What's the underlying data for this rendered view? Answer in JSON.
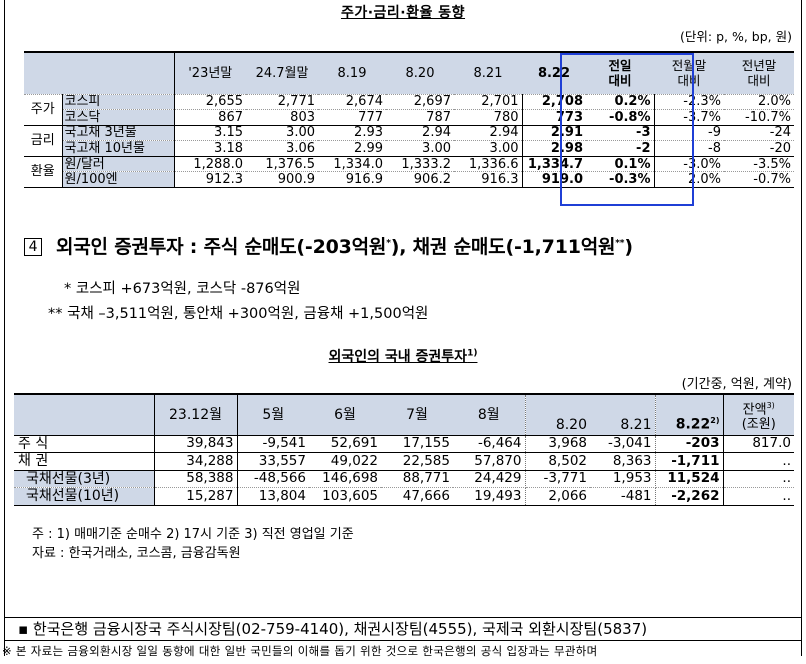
{
  "section1": {
    "title": "주가·금리·환율 동향",
    "unit_note": "(단위: p, %, bp, 원)",
    "headers": [
      "'23년말",
      "24.7월말",
      "8.19",
      "8.20",
      "8.21",
      "8.22",
      "전일\n대비",
      "전월말\n대비",
      "전년말\n대비"
    ],
    "rows": [
      {
        "group": "주가",
        "name": "코스피",
        "values": [
          "2,655",
          "2,771",
          "2,674",
          "2,697",
          "2,701",
          "2,708",
          "0.2%",
          "-2.3%",
          "2.0%"
        ]
      },
      {
        "group": "",
        "name": "코스닥",
        "values": [
          "867",
          "803",
          "777",
          "787",
          "780",
          "773",
          "-0.8%",
          "-3.7%",
          "-10.7%"
        ]
      },
      {
        "group": "금리",
        "name": "국고채 3년물",
        "values": [
          "3.15",
          "3.00",
          "2.93",
          "2.94",
          "2.94",
          "2.91",
          "-3",
          "-9",
          "-24"
        ]
      },
      {
        "group": "",
        "name": "국고채 10년물",
        "values": [
          "3.18",
          "3.06",
          "2.99",
          "3.00",
          "3.00",
          "2.98",
          "-2",
          "-8",
          "-20"
        ]
      },
      {
        "group": "환율",
        "name": "원/달러",
        "values": [
          "1,288.0",
          "1,376.5",
          "1,334.0",
          "1,333.2",
          "1,336.6",
          "1,334.7",
          "0.1%",
          "-3.0%",
          "-3.5%"
        ]
      },
      {
        "group": "",
        "name": "원/100엔",
        "values": [
          "912.3",
          "900.9",
          "916.9",
          "906.2",
          "916.3",
          "919.0",
          "-0.3%",
          "2.0%",
          "-0.7%"
        ]
      }
    ]
  },
  "section4": {
    "number": "4",
    "heading_a": "외국인 증권투자 : 주식 순매도(-203억원",
    "heading_sup1": "*",
    "heading_b": "), 채권 순매도(-1,711억원",
    "heading_sup2": "**",
    "heading_c": ")",
    "note1": "*  코스피  +673억원,  코스닥  -876억원",
    "note2": "**  국채  –3,511억원,  통안채  +300억원,  금융채  +1,500억원"
  },
  "section2": {
    "title": "외국인의  국내  증권투자",
    "title_sup": "1)",
    "unit_note": "(기간중,  억원,  계약)",
    "headers": [
      "23.12월",
      "5월",
      "6월",
      "7월",
      "8월",
      "8.20",
      "8.21",
      "8.22",
      "잔액",
      "(조원)"
    ],
    "header_sup_822": "2)",
    "header_sup_balance": "3)",
    "rows": [
      {
        "name": "주   식",
        "values": [
          "39,843",
          "-9,541",
          "52,691",
          "17,155",
          "-6,464",
          "3,968",
          "-3,041",
          "-203",
          "817.0"
        ]
      },
      {
        "name": "채   권",
        "values": [
          "34,288",
          "33,557",
          "49,022",
          "22,585",
          "57,870",
          "8,502",
          "8,363",
          "-1,711",
          ".."
        ]
      },
      {
        "name": "국채선물(3년)",
        "values": [
          "58,388",
          "-48,566",
          "146,698",
          "88,771",
          "24,429",
          "-3,771",
          "1,953",
          "11,524",
          ".."
        ]
      },
      {
        "name": "국채선물(10년)",
        "values": [
          "15,287",
          "13,804",
          "103,605",
          "47,666",
          "19,493",
          "2,066",
          "-481",
          "-2,262",
          ".."
        ]
      }
    ],
    "footnote1": "주 : 1) 매매기준 순매수     2) 17시 기준     3) 직전 영업일 기준",
    "footnote2": "자료 : 한국거래소, 코스콤, 금융감독원"
  },
  "contact": "▪ 한국은행  금융시장국  주식시장팀(02-759-4140),  채권시장팀(4555),  국제국  외환시장팀(5837)",
  "disclaimer": "※ 본 자료는 금융외환시장 일일 동향에 대한 일반 국민들의 이해를 돕기 위한 것으로 한국은행의 공식 입장과는 무관하며",
  "colors": {
    "header_bg": "#cfd8e7",
    "highlight_border": "#1f3fd6"
  }
}
